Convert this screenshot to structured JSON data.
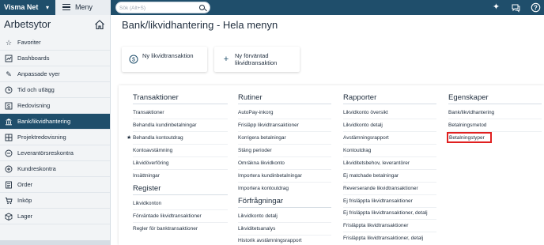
{
  "topbar": {
    "company": "Visma Net",
    "menu_label": "Meny",
    "search_placeholder": "Sök (Alt+S)"
  },
  "sidebar": {
    "title": "Arbetsytor",
    "items": [
      {
        "label": "Favoriter",
        "icon": "star-icon"
      },
      {
        "label": "Dashboards",
        "icon": "chart-icon"
      },
      {
        "label": "Anpassade vyer",
        "icon": "pencil-icon"
      },
      {
        "label": "Tid och utlägg",
        "icon": "clock-icon"
      },
      {
        "label": "Redovisning",
        "icon": "dollar-icon"
      },
      {
        "label": "Bank/likvidhantering",
        "icon": "bank-icon"
      },
      {
        "label": "Projektredovisning",
        "icon": "grid-icon"
      },
      {
        "label": "Leverantörsreskontra",
        "icon": "minus-circle-icon"
      },
      {
        "label": "Kundreskontra",
        "icon": "plus-circle-icon"
      },
      {
        "label": "Order",
        "icon": "list-icon"
      },
      {
        "label": "Inköp",
        "icon": "cart-icon"
      },
      {
        "label": "Lager",
        "icon": "box-icon"
      }
    ],
    "active_index": 5
  },
  "main": {
    "title": "Bank/likvidhantering - Hela menyn",
    "shortcuts": [
      {
        "label": "Ny likvidtransaktion",
        "icon": "clock-dollar-icon"
      },
      {
        "label": "Ny förväntad likvidtransaktion",
        "icon": "plus-icon"
      }
    ]
  },
  "menu": {
    "transaktioner": {
      "title": "Transaktioner",
      "links": [
        "Transaktioner",
        "Behandla kundinbetalningar",
        "Behandla kontoutdrag",
        "Kontoavstämning",
        "Likvidöverföring",
        "Insättningar"
      ],
      "starred_index": 2
    },
    "register": {
      "title": "Register",
      "links": [
        "Likvidkonton",
        "Förväntade likvidtransaktioner",
        "Regler för banktransaktioner"
      ]
    },
    "rutiner": {
      "title": "Rutiner",
      "links": [
        "AutoPay-inkorg",
        "Frisläpp likvidtransaktioner",
        "Korrigera betalningar",
        "Stäng perioder",
        "Omräkna likvidkonto",
        "Importera kundinbetalningar",
        "Importera kontoutdrag"
      ]
    },
    "forfragningar": {
      "title": "Förfrågningar",
      "links": [
        "Likvidkonto detalj",
        "Likviditetsanalys",
        "Historik avstämningsrapport"
      ]
    },
    "rapporter": {
      "title": "Rapporter",
      "links": [
        "Likvidkonto översikt",
        "Likvidkonto detalj",
        "Avstämningsrapport",
        "Kontoutdrag",
        "Likviditetsbehov, leverantörer",
        "Ej matchade betalningar",
        "Reverserande likvidtransaktioner",
        "Ej frisläppta likvidtransaktioner",
        "Ej frisläppta likvidtransaktioner, detalj",
        "Frisläppta likvidtransaktioner",
        "Frisläppta likvidtransaktioner, detalj"
      ]
    },
    "egenskaper": {
      "title": "Egenskaper",
      "links": [
        "Bank/likvidhantering",
        "Betalningsmetod",
        "Betalningstyper"
      ],
      "highlighted_index": 2
    }
  },
  "colors": {
    "topbar": "#1f4e6b",
    "active_sidebar": "#1f4e6b",
    "highlight": "#e02020"
  }
}
